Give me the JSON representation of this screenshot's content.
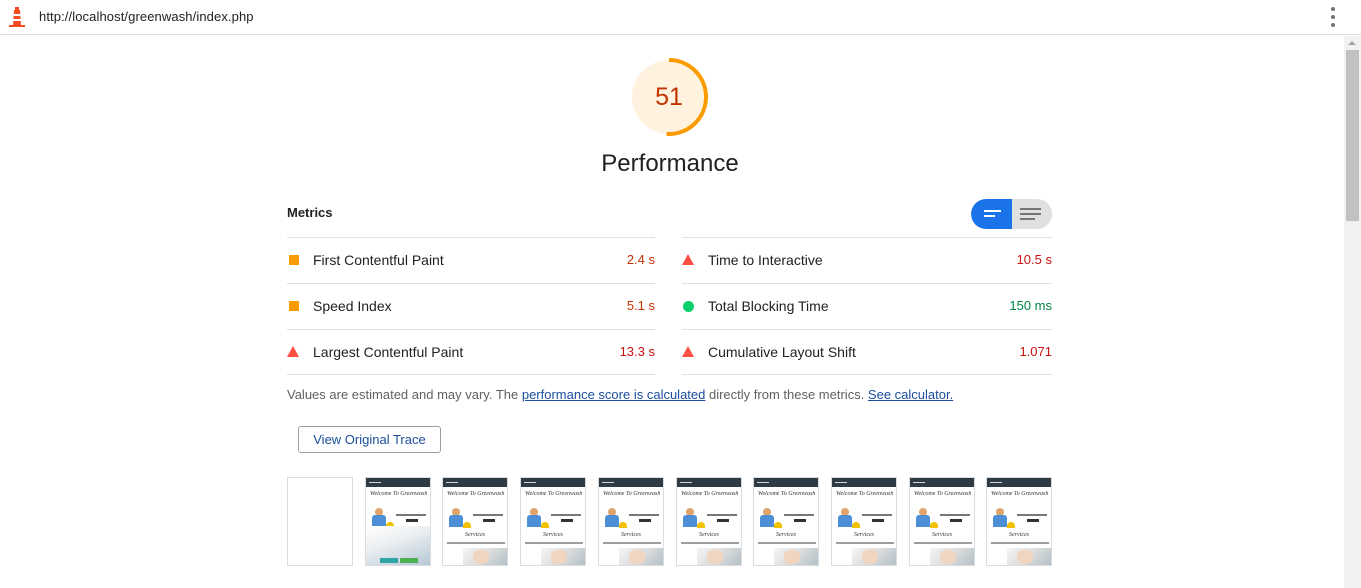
{
  "browser": {
    "url": "http://localhost/greenwash/index.php",
    "menu_icon": "kebab-menu-icon",
    "logo_icon": "lighthouse-icon"
  },
  "score": {
    "value": "51",
    "fraction": 0.51,
    "label": "Performance",
    "color": "#fa9c00"
  },
  "metrics": {
    "title": "Metrics",
    "left": [
      {
        "name": "First Contentful Paint",
        "value": "2.4 s",
        "status": "average"
      },
      {
        "name": "Speed Index",
        "value": "5.1 s",
        "status": "average"
      },
      {
        "name": "Largest Contentful Paint",
        "value": "13.3 s",
        "status": "fail"
      }
    ],
    "right": [
      {
        "name": "Time to Interactive",
        "value": "10.5 s",
        "status": "fail"
      },
      {
        "name": "Total Blocking Time",
        "value": "150 ms",
        "status": "pass"
      },
      {
        "name": "Cumulative Layout Shift",
        "value": "1.071",
        "status": "fail"
      }
    ]
  },
  "note": {
    "prefix": "Values are estimated and may vary. The ",
    "link1": "performance score is calculated",
    "middle": " directly from these metrics. ",
    "link2": "See calculator."
  },
  "trace_button": "View Original Trace",
  "filmstrip": {
    "headline": "Welcome To Greenwash",
    "section": "Services",
    "frame_count": 10
  },
  "colors": {
    "average": "#fa9c00",
    "fail": "#ff4e42",
    "pass": "#0cce6b",
    "accent": "#1a73e8"
  }
}
